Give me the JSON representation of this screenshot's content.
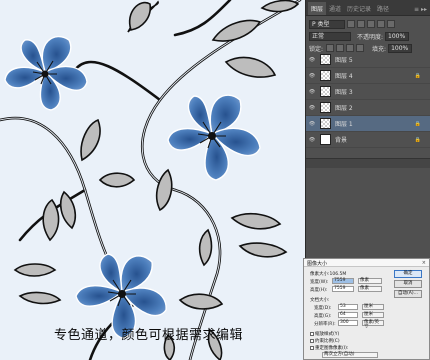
{
  "caption": "专色通道，颜色可根据需求编辑",
  "panel": {
    "tabs": [
      "图层",
      "通道",
      "历史记录",
      "路径"
    ],
    "active_tab": 0,
    "tab_tools": "≡ ▸▸",
    "filter_label": "P 类型",
    "blend_mode": "正常",
    "opacity_label": "不透明度:",
    "opacity_value": "100%",
    "lock_label": "锁定:",
    "fill_label": "填充:",
    "fill_value": "100%",
    "layers": [
      {
        "name": "图层 5",
        "selected": false,
        "locked": false,
        "thumb": "transparent"
      },
      {
        "name": "图层 4",
        "selected": false,
        "locked": true,
        "thumb": "transparent"
      },
      {
        "name": "图层 3",
        "selected": false,
        "locked": false,
        "thumb": "transparent"
      },
      {
        "name": "图层 2",
        "selected": false,
        "locked": false,
        "thumb": "transparent"
      },
      {
        "name": "图层 1",
        "selected": true,
        "locked": true,
        "thumb": "transparent"
      },
      {
        "name": "背景",
        "selected": false,
        "locked": true,
        "thumb": "white"
      }
    ],
    "eye_icon": "eye-icon",
    "lock_icon": "lock-icon"
  },
  "dialog": {
    "title": "图像大小",
    "close": "×",
    "pixel_size": "像素大小:106.5M",
    "width_label": "宽度(W):",
    "width_value": "7559",
    "height_label": "高度(H):",
    "height_value": "7559",
    "unit_pixels": "像素",
    "doc_size_label": "文档大小:",
    "doc_width_label": "宽度(D):",
    "doc_width_value": "53",
    "doc_height_label": "高度(G):",
    "doc_height_value": "64",
    "resolution_label": "分辨率(R):",
    "resolution_value": "300",
    "unit_cm": "厘米",
    "unit_res": "像素/英寸",
    "scale_styles": "缩放样式(Y)",
    "constrain": "约束比例(C)",
    "resample": "重定图像像素(I):",
    "resample_method": "两次立方(自动)",
    "ok": "确定",
    "cancel": "取消",
    "auto": "自动(A)..."
  },
  "colors": {
    "petal_dark": "#2f5f9e",
    "petal_mid": "#4d7fbd",
    "petal_light": "#b9cbe4",
    "leaf": "#bcbcbc",
    "stem": "#1a1a1a",
    "background": "#eaf1f9",
    "panel": "#505050",
    "selected_layer": "#566a82"
  }
}
